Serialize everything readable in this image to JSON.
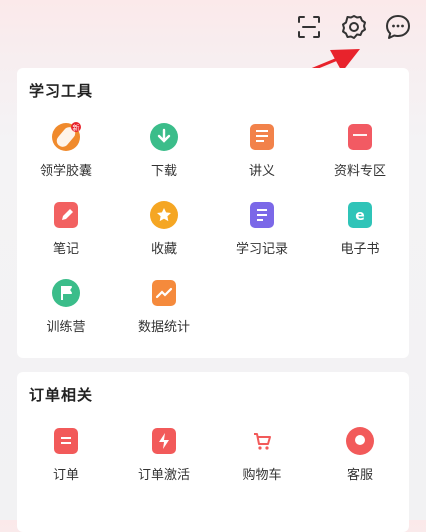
{
  "header": {
    "icons": [
      "scan-icon",
      "gear-icon",
      "message-icon"
    ]
  },
  "tools": {
    "title": "学习工具",
    "items": [
      {
        "label": "领学胶囊",
        "icon": "capsule-icon",
        "color": "#f08a2c"
      },
      {
        "label": "下载",
        "icon": "download-icon",
        "color": "#3bbd8a"
      },
      {
        "label": "讲义",
        "icon": "book-icon",
        "color": "#f2824a"
      },
      {
        "label": "资料专区",
        "icon": "folder-icon",
        "color": "#f25a63"
      },
      {
        "label": "笔记",
        "icon": "note-icon",
        "color": "#f26161"
      },
      {
        "label": "收藏",
        "icon": "star-icon",
        "color": "#f5a623"
      },
      {
        "label": "学习记录",
        "icon": "record-icon",
        "color": "#7b68e8"
      },
      {
        "label": "电子书",
        "icon": "ebook-icon",
        "color": "#2fc4b8"
      },
      {
        "label": "训练营",
        "icon": "flag-icon",
        "color": "#3bbd8a"
      },
      {
        "label": "数据统计",
        "icon": "chart-icon",
        "color": "#f58a3c"
      }
    ]
  },
  "orders": {
    "title": "订单相关",
    "items": [
      {
        "label": "订单",
        "icon": "order-icon",
        "color": "#f25a5a"
      },
      {
        "label": "订单激活",
        "icon": "activate-icon",
        "color": "#f25a5a"
      },
      {
        "label": "购物车",
        "icon": "cart-icon",
        "color": "#f25a5a"
      },
      {
        "label": "客服",
        "icon": "service-icon",
        "color": "#f25a5a"
      }
    ]
  }
}
